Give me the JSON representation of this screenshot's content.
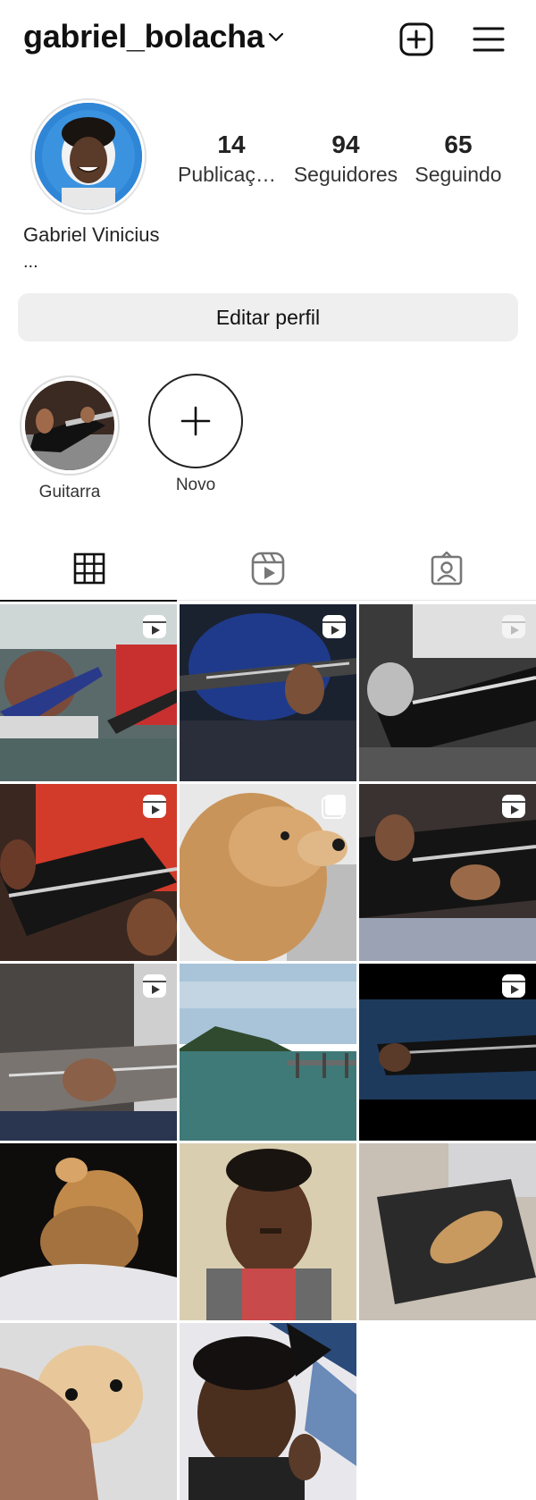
{
  "header": {
    "username": "gabriel_bolacha",
    "chevron_icon": "chevron-down-icon",
    "add_icon": "plus-square-icon",
    "menu_icon": "hamburger-menu-icon"
  },
  "profile": {
    "stats": [
      {
        "value": "14",
        "label": "Publicações"
      },
      {
        "value": "94",
        "label": "Seguidores"
      },
      {
        "value": "65",
        "label": "Seguindo"
      }
    ],
    "full_name": "Gabriel Vinicius",
    "bio": "...",
    "edit_button": "Editar perfil"
  },
  "highlights": [
    {
      "label": "Guitarra"
    },
    {
      "label": "Novo"
    }
  ],
  "tabs": [
    {
      "name": "grid-icon",
      "active": true
    },
    {
      "name": "reels-icon",
      "active": false
    },
    {
      "name": "tagged-icon",
      "active": false
    }
  ],
  "grid": {
    "posts": [
      {
        "kind": "reel",
        "theme": "two guitarists"
      },
      {
        "kind": "reel",
        "theme": "guitar blue shirt"
      },
      {
        "kind": "reel",
        "theme": "guitar bw"
      },
      {
        "kind": "reel",
        "theme": "guitar red shirt"
      },
      {
        "kind": "carousel",
        "theme": "dog closeup"
      },
      {
        "kind": "reel",
        "theme": "guitar gray pants"
      },
      {
        "kind": "reel",
        "theme": "guitar dark"
      },
      {
        "kind": "photo",
        "theme": "sea and pier"
      },
      {
        "kind": "reel",
        "theme": "guitar night"
      },
      {
        "kind": "photo",
        "theme": "dog on bed"
      },
      {
        "kind": "photo",
        "theme": "selfie red shirt"
      },
      {
        "kind": "photo",
        "theme": "dog on cushion"
      },
      {
        "kind": "photo",
        "theme": "dog held by hand"
      },
      {
        "kind": "photo",
        "theme": "selfie headphones"
      }
    ]
  },
  "colors": {
    "text": "#111111",
    "button_bg": "#efefef",
    "divider": "#e6e6e6",
    "avatar_bg": "#2f7fd0"
  }
}
